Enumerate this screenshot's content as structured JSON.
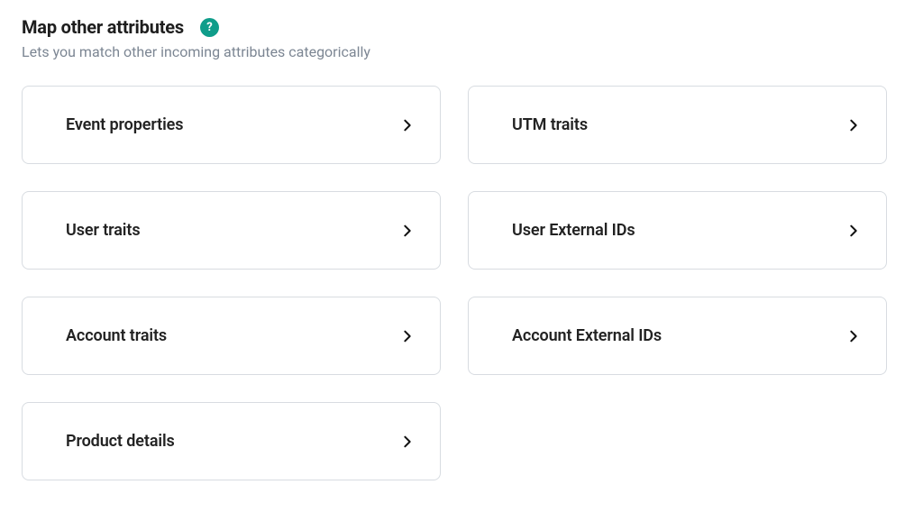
{
  "header": {
    "title": "Map other attributes",
    "help_icon": "?",
    "subtitle": "Lets you match other incoming attributes categorically"
  },
  "cards": {
    "event_properties": {
      "label": "Event properties"
    },
    "utm_traits": {
      "label": "UTM traits"
    },
    "user_traits": {
      "label": "User traits"
    },
    "user_external_ids": {
      "label": "User External IDs"
    },
    "account_traits": {
      "label": "Account traits"
    },
    "account_external_ids": {
      "label": "Account External IDs"
    },
    "product_details": {
      "label": "Product details"
    }
  }
}
